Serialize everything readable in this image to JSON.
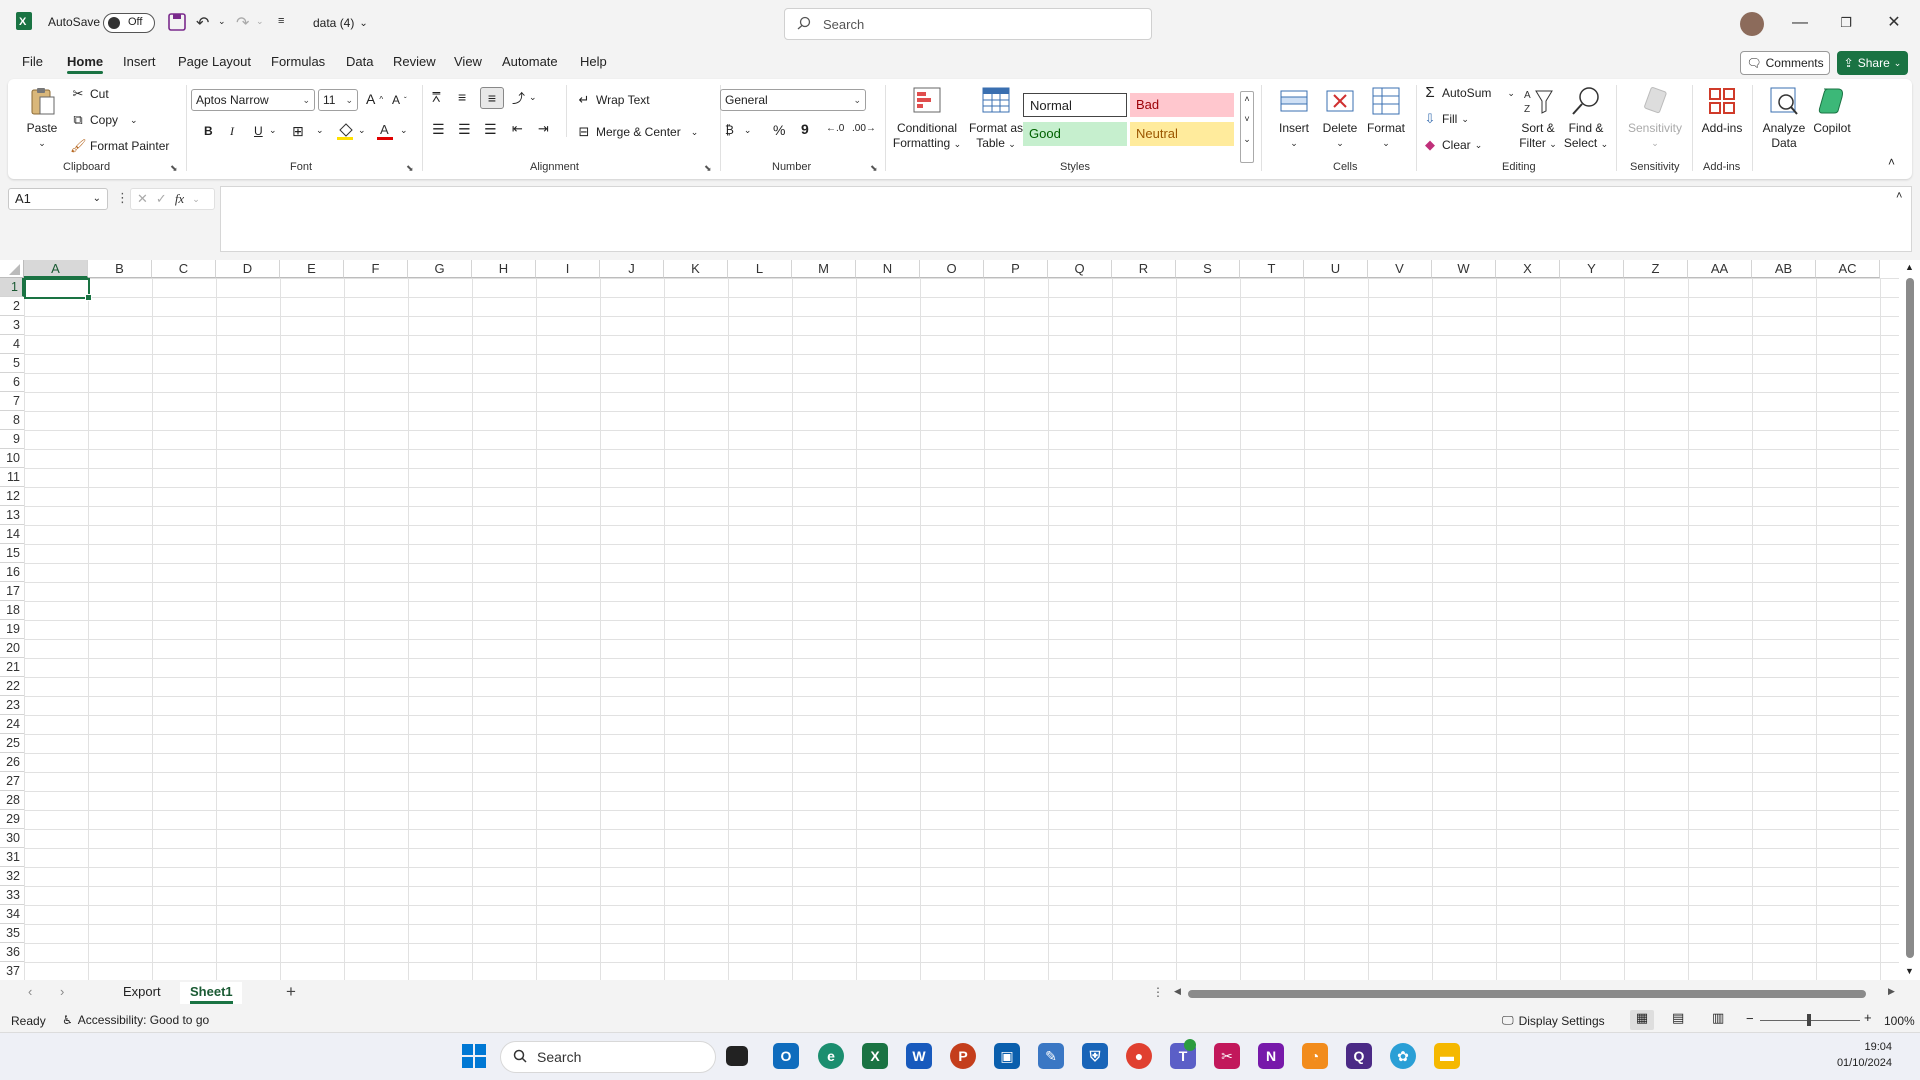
{
  "titlebar": {
    "autosave_label": "AutoSave",
    "autosave_state": "Off",
    "filename": "data (4)",
    "search_placeholder": "Search"
  },
  "tabs": [
    "File",
    "Home",
    "Insert",
    "Page Layout",
    "Formulas",
    "Data",
    "Review",
    "View",
    "Automate",
    "Help"
  ],
  "active_tab": "Home",
  "header_buttons": {
    "comments": "Comments",
    "share": "Share"
  },
  "ribbon": {
    "clipboard": {
      "paste": "Paste",
      "cut": "Cut",
      "copy": "Copy",
      "format_painter": "Format Painter",
      "label": "Clipboard"
    },
    "font": {
      "name": "Aptos Narrow",
      "size": "11",
      "label": "Font",
      "bold": "B",
      "italic": "I",
      "underline": "U"
    },
    "alignment": {
      "wrap_text": "Wrap Text",
      "merge_center": "Merge & Center",
      "label": "Alignment"
    },
    "number": {
      "format": "General",
      "label": "Number",
      "percent": "%",
      "comma": "9"
    },
    "styles": {
      "conditional_formatting_1": "Conditional",
      "conditional_formatting_2": "Formatting",
      "format_as_table_1": "Format as",
      "format_as_table_2": "Table",
      "normal": "Normal",
      "bad": "Bad",
      "good": "Good",
      "neutral": "Neutral",
      "label": "Styles"
    },
    "cells": {
      "insert": "Insert",
      "delete": "Delete",
      "format": "Format",
      "label": "Cells"
    },
    "editing": {
      "autosum": "AutoSum",
      "fill": "Fill",
      "clear": "Clear",
      "sort_filter_1": "Sort &",
      "sort_filter_2": "Filter",
      "find_select_1": "Find &",
      "find_select_2": "Select",
      "label": "Editing"
    },
    "sensitivity": {
      "button": "Sensitivity",
      "label": "Sensitivity"
    },
    "addins": {
      "button": "Add-ins",
      "label": "Add-ins"
    },
    "analyze_data_1": "Analyze",
    "analyze_data_2": "Data",
    "copilot": "Copilot"
  },
  "formula_bar": {
    "name_box": "A1",
    "fx": "fx",
    "formula": ""
  },
  "grid": {
    "columns": [
      "A",
      "B",
      "C",
      "D",
      "E",
      "F",
      "G",
      "H",
      "I",
      "J",
      "K",
      "L",
      "M",
      "N",
      "O",
      "P",
      "Q",
      "R",
      "S",
      "T",
      "U",
      "V",
      "W",
      "X",
      "Y",
      "Z",
      "AA",
      "AB",
      "AC"
    ],
    "rows": 37,
    "active_cell": "A1"
  },
  "sheets": [
    "Export",
    "Sheet1"
  ],
  "active_sheet": "Sheet1",
  "statusbar": {
    "ready": "Ready",
    "accessibility": "Accessibility: Good to go",
    "display_settings": "Display Settings",
    "zoom": "100%"
  },
  "taskbar": {
    "search": "Search",
    "time": "19:04",
    "date": "01/10/2024"
  },
  "colors": {
    "accent": "#1a7343",
    "bad_bg": "#ffc7ce",
    "good_bg": "#c6efce",
    "neutral_bg": "#ffeb9c"
  }
}
